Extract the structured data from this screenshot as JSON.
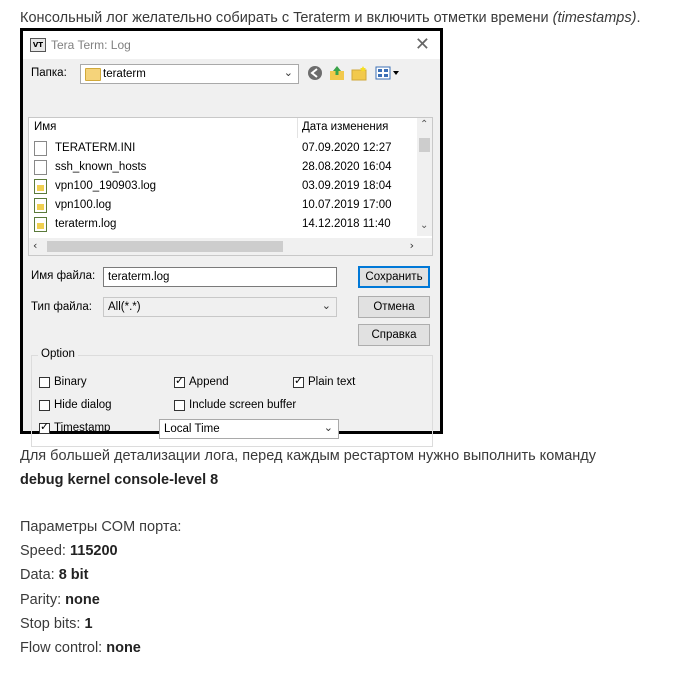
{
  "intro": {
    "text": "Консольный лог желательно собирать с Teraterm и включить отметки времени ",
    "italic": "(timestamps)",
    "end": "."
  },
  "dialog": {
    "app_icon": "VT",
    "title": "Tera Term: Log",
    "close": "✕",
    "folder_label": "Папка:",
    "folder_value": "teraterm",
    "toolbar_icons": [
      "back-icon",
      "up-folder-icon",
      "new-folder-icon",
      "view-menu-icon"
    ],
    "columns": {
      "name": "Имя",
      "date": "Дата изменения"
    },
    "files": [
      {
        "name": "TERATERM.INI",
        "date": "07.09.2020 12:27",
        "icon": "ini-file-icon"
      },
      {
        "name": "ssh_known_hosts",
        "date": "28.08.2020 16:04",
        "icon": "file-icon"
      },
      {
        "name": "vpn100_190903.log",
        "date": "03.09.2019 18:04",
        "icon": "log-file-icon"
      },
      {
        "name": "vpn100.log",
        "date": "10.07.2019 17:00",
        "icon": "log-file-icon"
      },
      {
        "name": "teraterm.log",
        "date": "14.12.2018 11:40",
        "icon": "log-file-icon"
      }
    ],
    "filename_label": "Имя файла:",
    "filename_value": "teraterm.log",
    "filetype_label": "Тип файла:",
    "filetype_value": "All(*.*)",
    "buttons": {
      "save": "Сохранить",
      "cancel": "Отмена",
      "help": "Справка"
    },
    "option": {
      "title": "Option",
      "binary": {
        "label": "Binary",
        "checked": false
      },
      "append": {
        "label": "Append",
        "checked": true
      },
      "plain_text": {
        "label": "Plain text",
        "checked": true
      },
      "hide_dialog": {
        "label": "Hide dialog",
        "checked": false
      },
      "include_screen_buffer": {
        "label": "Include screen buffer",
        "checked": false
      },
      "timestamp": {
        "label": "Timestamp",
        "checked": true
      },
      "time_mode": "Local Time"
    }
  },
  "para1": {
    "line1": "Для большей детализации лога, перед каждым рестартом нужно выполнить команду",
    "command": "debug kernel console-level 8"
  },
  "com": {
    "heading": "Параметры COM порта:",
    "params": [
      {
        "label": "Speed: ",
        "value": "115200"
      },
      {
        "label": "Data: ",
        "value": "8 bit"
      },
      {
        "label": "Parity: ",
        "value": "none"
      },
      {
        "label": "Stop bits: ",
        "value": "1"
      },
      {
        "label": "Flow control: ",
        "value": "none"
      }
    ]
  }
}
